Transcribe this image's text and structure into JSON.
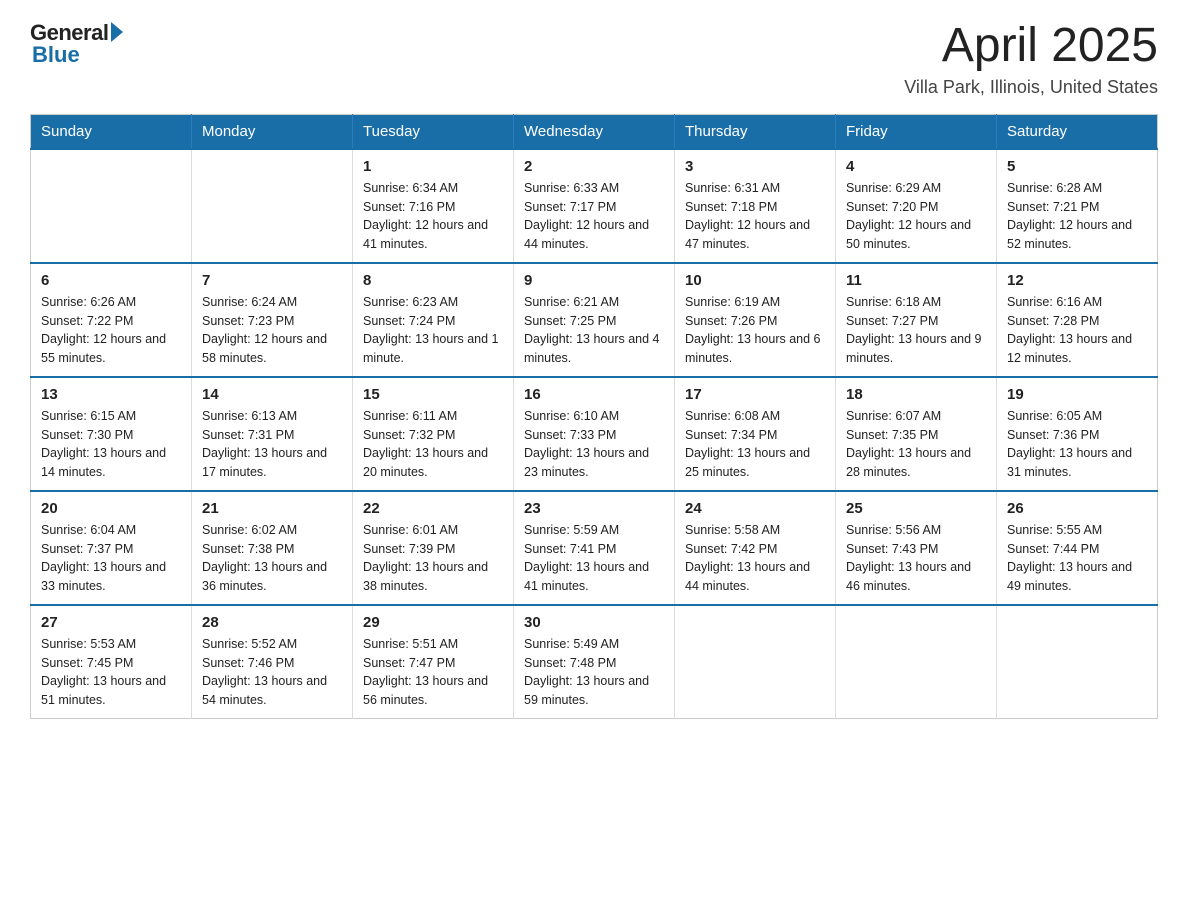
{
  "logo": {
    "general": "General",
    "blue": "Blue"
  },
  "title": "April 2025",
  "subtitle": "Villa Park, Illinois, United States",
  "days_of_week": [
    "Sunday",
    "Monday",
    "Tuesday",
    "Wednesday",
    "Thursday",
    "Friday",
    "Saturday"
  ],
  "weeks": [
    [
      {
        "day": "",
        "info": ""
      },
      {
        "day": "",
        "info": ""
      },
      {
        "day": "1",
        "info": "Sunrise: 6:34 AM\nSunset: 7:16 PM\nDaylight: 12 hours\nand 41 minutes."
      },
      {
        "day": "2",
        "info": "Sunrise: 6:33 AM\nSunset: 7:17 PM\nDaylight: 12 hours\nand 44 minutes."
      },
      {
        "day": "3",
        "info": "Sunrise: 6:31 AM\nSunset: 7:18 PM\nDaylight: 12 hours\nand 47 minutes."
      },
      {
        "day": "4",
        "info": "Sunrise: 6:29 AM\nSunset: 7:20 PM\nDaylight: 12 hours\nand 50 minutes."
      },
      {
        "day": "5",
        "info": "Sunrise: 6:28 AM\nSunset: 7:21 PM\nDaylight: 12 hours\nand 52 minutes."
      }
    ],
    [
      {
        "day": "6",
        "info": "Sunrise: 6:26 AM\nSunset: 7:22 PM\nDaylight: 12 hours\nand 55 minutes."
      },
      {
        "day": "7",
        "info": "Sunrise: 6:24 AM\nSunset: 7:23 PM\nDaylight: 12 hours\nand 58 minutes."
      },
      {
        "day": "8",
        "info": "Sunrise: 6:23 AM\nSunset: 7:24 PM\nDaylight: 13 hours\nand 1 minute."
      },
      {
        "day": "9",
        "info": "Sunrise: 6:21 AM\nSunset: 7:25 PM\nDaylight: 13 hours\nand 4 minutes."
      },
      {
        "day": "10",
        "info": "Sunrise: 6:19 AM\nSunset: 7:26 PM\nDaylight: 13 hours\nand 6 minutes."
      },
      {
        "day": "11",
        "info": "Sunrise: 6:18 AM\nSunset: 7:27 PM\nDaylight: 13 hours\nand 9 minutes."
      },
      {
        "day": "12",
        "info": "Sunrise: 6:16 AM\nSunset: 7:28 PM\nDaylight: 13 hours\nand 12 minutes."
      }
    ],
    [
      {
        "day": "13",
        "info": "Sunrise: 6:15 AM\nSunset: 7:30 PM\nDaylight: 13 hours\nand 14 minutes."
      },
      {
        "day": "14",
        "info": "Sunrise: 6:13 AM\nSunset: 7:31 PM\nDaylight: 13 hours\nand 17 minutes."
      },
      {
        "day": "15",
        "info": "Sunrise: 6:11 AM\nSunset: 7:32 PM\nDaylight: 13 hours\nand 20 minutes."
      },
      {
        "day": "16",
        "info": "Sunrise: 6:10 AM\nSunset: 7:33 PM\nDaylight: 13 hours\nand 23 minutes."
      },
      {
        "day": "17",
        "info": "Sunrise: 6:08 AM\nSunset: 7:34 PM\nDaylight: 13 hours\nand 25 minutes."
      },
      {
        "day": "18",
        "info": "Sunrise: 6:07 AM\nSunset: 7:35 PM\nDaylight: 13 hours\nand 28 minutes."
      },
      {
        "day": "19",
        "info": "Sunrise: 6:05 AM\nSunset: 7:36 PM\nDaylight: 13 hours\nand 31 minutes."
      }
    ],
    [
      {
        "day": "20",
        "info": "Sunrise: 6:04 AM\nSunset: 7:37 PM\nDaylight: 13 hours\nand 33 minutes."
      },
      {
        "day": "21",
        "info": "Sunrise: 6:02 AM\nSunset: 7:38 PM\nDaylight: 13 hours\nand 36 minutes."
      },
      {
        "day": "22",
        "info": "Sunrise: 6:01 AM\nSunset: 7:39 PM\nDaylight: 13 hours\nand 38 minutes."
      },
      {
        "day": "23",
        "info": "Sunrise: 5:59 AM\nSunset: 7:41 PM\nDaylight: 13 hours\nand 41 minutes."
      },
      {
        "day": "24",
        "info": "Sunrise: 5:58 AM\nSunset: 7:42 PM\nDaylight: 13 hours\nand 44 minutes."
      },
      {
        "day": "25",
        "info": "Sunrise: 5:56 AM\nSunset: 7:43 PM\nDaylight: 13 hours\nand 46 minutes."
      },
      {
        "day": "26",
        "info": "Sunrise: 5:55 AM\nSunset: 7:44 PM\nDaylight: 13 hours\nand 49 minutes."
      }
    ],
    [
      {
        "day": "27",
        "info": "Sunrise: 5:53 AM\nSunset: 7:45 PM\nDaylight: 13 hours\nand 51 minutes."
      },
      {
        "day": "28",
        "info": "Sunrise: 5:52 AM\nSunset: 7:46 PM\nDaylight: 13 hours\nand 54 minutes."
      },
      {
        "day": "29",
        "info": "Sunrise: 5:51 AM\nSunset: 7:47 PM\nDaylight: 13 hours\nand 56 minutes."
      },
      {
        "day": "30",
        "info": "Sunrise: 5:49 AM\nSunset: 7:48 PM\nDaylight: 13 hours\nand 59 minutes."
      },
      {
        "day": "",
        "info": ""
      },
      {
        "day": "",
        "info": ""
      },
      {
        "day": "",
        "info": ""
      }
    ]
  ]
}
